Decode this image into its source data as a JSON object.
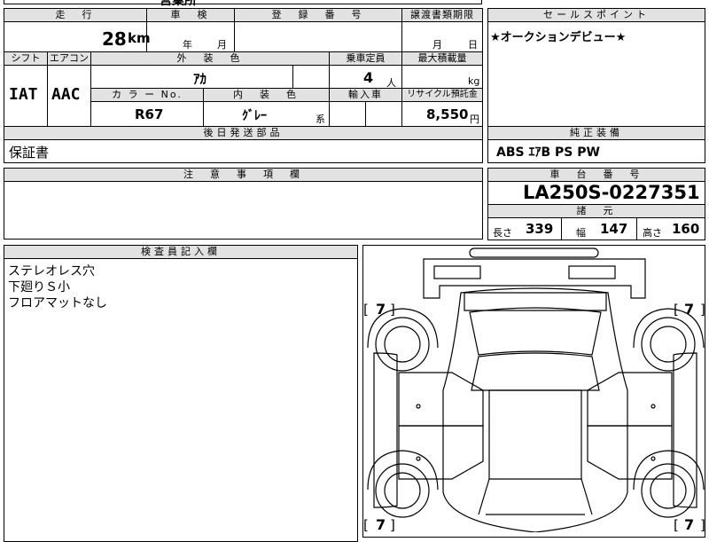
{
  "top_partial": {
    "model": "営業所"
  },
  "mileage": {
    "header": "走　行",
    "value": "28",
    "unit": "km"
  },
  "inspection": {
    "header": "車　検",
    "year_unit": "年",
    "month_unit": "月"
  },
  "registration": {
    "header": "登　録　番　号"
  },
  "transfer_deadline": {
    "header": "譲渡書類期限",
    "month_unit": "月",
    "day_unit": "日"
  },
  "sales_point": {
    "header": "セールスポイント",
    "text": "★オークションデビュー★"
  },
  "shift": {
    "header": "シフト",
    "value": "IAT"
  },
  "aircon": {
    "header": "エアコン",
    "value": "AAC"
  },
  "exterior_color": {
    "header": "外　装　色",
    "value": "ｱｶ"
  },
  "capacity": {
    "header": "乗車定員",
    "value": "4",
    "unit": "人"
  },
  "max_load": {
    "header": "最大積載量",
    "unit": "kg"
  },
  "color_no": {
    "header": "カ ラ ー No.",
    "value": "R67"
  },
  "interior_color": {
    "header": "内　装　色",
    "value": "ｸﾞﾚｰ",
    "suffix": "系"
  },
  "import": {
    "header": "輸入車"
  },
  "recycle": {
    "header": "リサイクル預託金",
    "value": "8,550",
    "unit": "円"
  },
  "shipping_parts": {
    "header": "後日発送部品",
    "text": "保証書"
  },
  "equipment": {
    "header": "純正装備",
    "text": "ABS ｴｱB PS PW"
  },
  "notes": {
    "header": "注　意　事　項　欄"
  },
  "chassis": {
    "header": "車　台　番　号",
    "value": "LA250S-0227351"
  },
  "specs": {
    "header": "諸　元",
    "length_label": "長さ",
    "length": "339",
    "width_label": "幅",
    "width": "147",
    "height_label": "高さ",
    "height": "160"
  },
  "inspector": {
    "header": "検査員記入欄",
    "lines": [
      "ステレオレス穴",
      "下廻りＳ小",
      "フロアマットなし"
    ]
  },
  "diagram": {
    "tire_front_left": "7",
    "tire_front_right": "7",
    "tire_rear_left": "7",
    "tire_rear_right": "7"
  }
}
